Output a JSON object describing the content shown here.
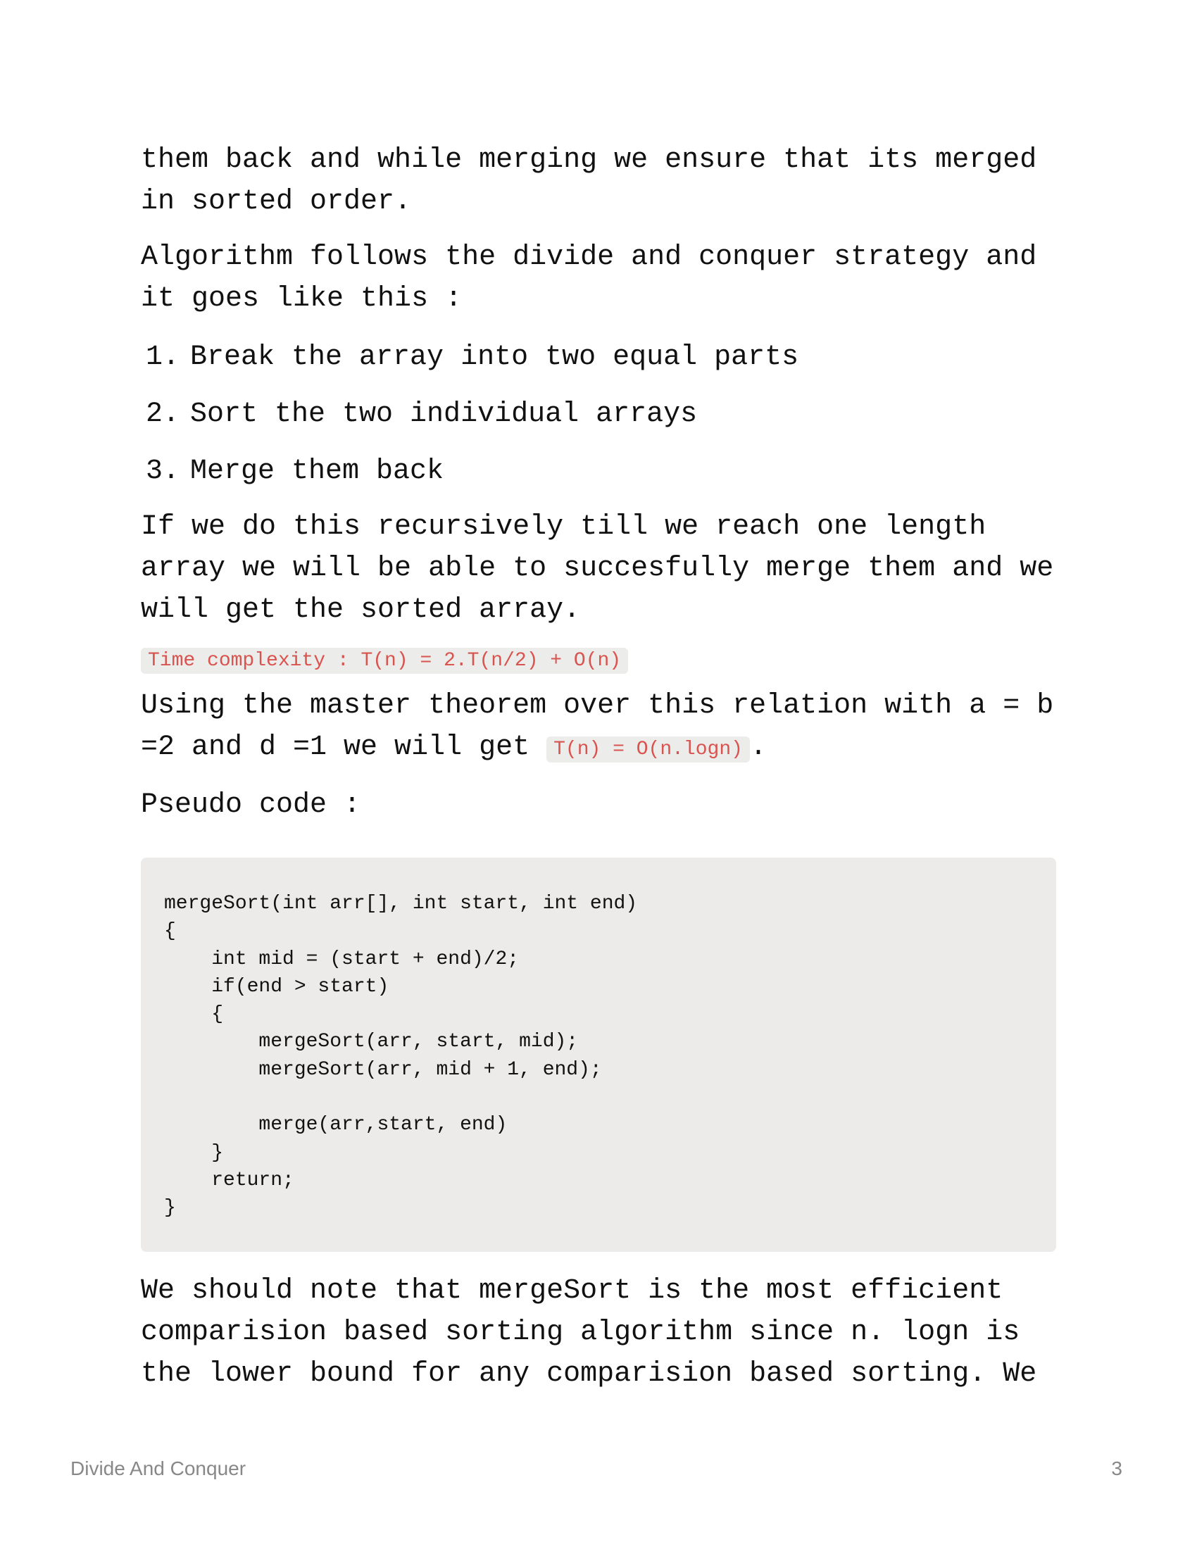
{
  "document": {
    "paragraphs": {
      "intro_continuation": "them back and while merging we ensure that its merged in sorted order.",
      "strategy": "Algorithm follows the divide and conquer strategy and it goes like this :",
      "recursion": "If we do this recursively till we reach one length array we will be able to succesfully merge them and we will get the sorted array.",
      "master_theorem_prefix": "Using the master theorem over this relation with a = b =2 and d =1 we will get ",
      "master_theorem_suffix": ".",
      "pseudo_heading": "Pseudo code :",
      "conclusion": "We should note that mergeSort is the most efficient comparision based sorting algorithm since n. logn is the lower bound for any comparision based sorting. We"
    },
    "steps": [
      {
        "number": "1.",
        "text": "Break the array into two equal parts"
      },
      {
        "number": "2.",
        "text": "Sort the two individual arrays"
      },
      {
        "number": "3.",
        "text": "Merge them back"
      }
    ],
    "inline_code": {
      "time_complexity": "Time complexity : T(n) = 2.T(n/2) + O(n)",
      "result": "T(n) = O(n.logn)"
    },
    "code_block": "mergeSort(int arr[], int start, int end)\n{\n    int mid = (start + end)/2;\n    if(end > start)\n    {\n        mergeSort(arr, start, mid);\n        mergeSort(arr, mid + 1, end);\n\n        merge(arr,start, end)\n    }\n    return;\n}"
  },
  "footer": {
    "title": "Divide And Conquer",
    "page_number": "3"
  },
  "colors": {
    "inline_code_text": "#d9534f",
    "code_background": "#ecebe9",
    "footer_text": "#888888"
  }
}
